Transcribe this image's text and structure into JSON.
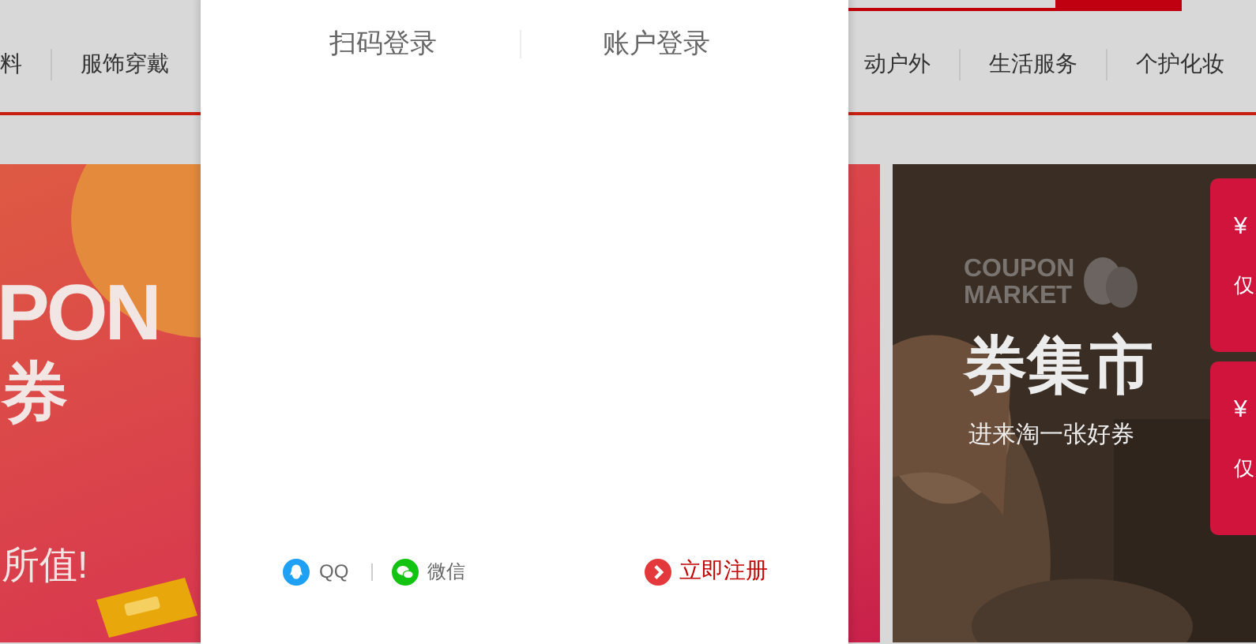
{
  "header": {
    "left_nav": [
      {
        "label": "料"
      },
      {
        "label": "服饰穿戴"
      }
    ],
    "right_nav": [
      {
        "label": "动户外"
      },
      {
        "label": "生活服务"
      },
      {
        "label": "个护化妆"
      }
    ]
  },
  "left_banner": {
    "headline": "PON",
    "title": "券",
    "slogan": "所值!"
  },
  "right_banner": {
    "logo": [
      "COUPON",
      "MARKET"
    ],
    "title": "券集市",
    "subtitle": "进来淘一张好券",
    "coupons": [
      {
        "currency": "¥",
        "note": "仅"
      },
      {
        "currency": "¥",
        "note": "仅"
      }
    ]
  },
  "login_modal": {
    "tabs": [
      {
        "label": "扫码登录"
      },
      {
        "label": "账户登录"
      }
    ],
    "social": [
      {
        "kind": "qq",
        "label": "QQ"
      },
      {
        "kind": "wechat",
        "label": "微信"
      }
    ],
    "register": "立即注册"
  }
}
